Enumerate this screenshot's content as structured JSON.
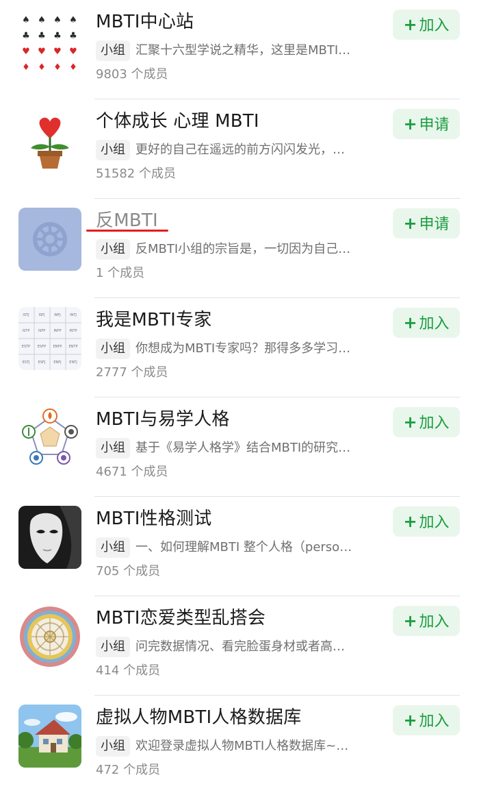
{
  "groups": [
    {
      "name": "MBTI中心站",
      "type_tag": "小组",
      "description": "汇聚十六型学说之精华，这里是MBTI…",
      "members": "9803 个成员",
      "action_icon": "+",
      "action_label": "加入",
      "avatar_icon": "playing-cards-grid-icon"
    },
    {
      "name": "个体成长 心理 MBTI",
      "type_tag": "小组",
      "description": "更好的自己在遥远的前方闪闪发光，…",
      "members": "51582 个成员",
      "action_icon": "+",
      "action_label": "申请",
      "avatar_icon": "heart-flower-pot-icon"
    },
    {
      "name": "反MBTI",
      "type_tag": "小组",
      "description": "反MBTI小组的宗旨是，一切因为自己…",
      "members": "1 个成员",
      "action_icon": "+",
      "action_label": "申请",
      "avatar_icon": "default-group-icon",
      "highlighted": true
    },
    {
      "name": "我是MBTI专家",
      "type_tag": "小组",
      "description": "你想成为MBTI专家吗？那得多多学习…",
      "members": "2777 个成员",
      "action_icon": "+",
      "action_label": "加入",
      "avatar_icon": "mbti-type-table-icon"
    },
    {
      "name": "MBTI与易学人格",
      "type_tag": "小组",
      "description": "基于《易学人格学》结合MBTI的研究…",
      "members": "4671 个成员",
      "action_icon": "+",
      "action_label": "加入",
      "avatar_icon": "five-elements-diagram-icon"
    },
    {
      "name": "MBTI性格测试",
      "type_tag": "小组",
      "description": "一、如何理解MBTI 整个人格（perso…",
      "members": "705 个成员",
      "action_icon": "+",
      "action_label": "加入",
      "avatar_icon": "white-mask-photo-icon"
    },
    {
      "name": "MBTI恋爱类型乱搭会",
      "type_tag": "小组",
      "description": "问完数据情况、看完脸蛋身材或者高…",
      "members": "414 个成员",
      "action_icon": "+",
      "action_label": "加入",
      "avatar_icon": "circular-mandala-icon"
    },
    {
      "name": "虚拟人物MBTI人格数据库",
      "type_tag": "小组",
      "description": "欢迎登录虚拟人物MBTI人格数据库~…",
      "members": "472 个成员",
      "action_icon": "+",
      "action_label": "加入",
      "avatar_icon": "anime-house-scene-icon"
    }
  ],
  "colors": {
    "button_background": "#e9f6ec",
    "button_text": "#1a9d3f",
    "highlight_underline": "#e31b1b",
    "divider": "#e2e2e2"
  }
}
